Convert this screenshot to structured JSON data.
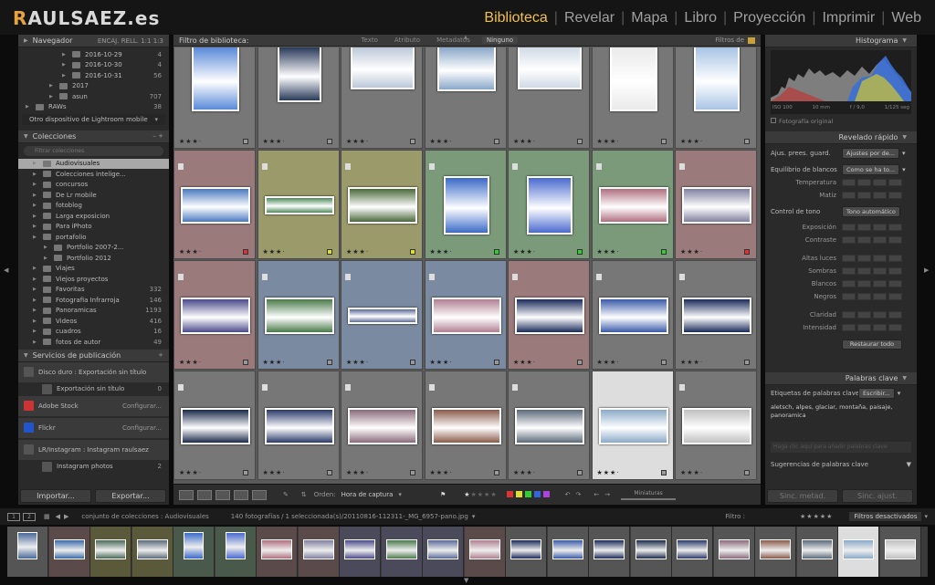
{
  "header": {
    "logo_a": "R",
    "logo_b": "AULSAEZ.es",
    "logo_y": "",
    "modules": [
      "Biblioteca",
      "Revelar",
      "Mapa",
      "Libro",
      "Proyección",
      "Imprimir",
      "Web"
    ],
    "active_module": "Biblioteca"
  },
  "left": {
    "navigator": {
      "title": "Navegador",
      "zoom_opts": "ENCAJ.   RELL.   1:1   1:3"
    },
    "folders": [
      {
        "label": "2016-10-29",
        "count": "4"
      },
      {
        "label": "2016-10-30",
        "count": "4"
      },
      {
        "label": "2016-10-31",
        "count": "56"
      },
      {
        "label": "2017",
        "count": ""
      },
      {
        "label": "asun",
        "count": "707"
      }
    ],
    "raws": {
      "label": "RAWs",
      "count": "38"
    },
    "mobile": "Otro dispositivo de Lightroom mobile",
    "collections_title": "Colecciones",
    "collections_filter_placeholder": "Filtrar colecciones",
    "collections": [
      {
        "label": "Audiovisuales",
        "count": "",
        "sel": true
      },
      {
        "label": "Colecciones intelige...",
        "count": ""
      },
      {
        "label": "concursos",
        "count": ""
      },
      {
        "label": "De Lr mobile",
        "count": ""
      },
      {
        "label": "fotoblog",
        "count": ""
      },
      {
        "label": "Larga exposicion",
        "count": ""
      },
      {
        "label": "Para iPhoto",
        "count": ""
      },
      {
        "label": "portafolio",
        "count": ""
      },
      {
        "label": "Portfolio 2007-2...",
        "count": "",
        "sub": true
      },
      {
        "label": "Portfolio 2012",
        "count": "",
        "sub": true
      },
      {
        "label": "Viajes",
        "count": ""
      },
      {
        "label": "Viejos proyectos",
        "count": ""
      },
      {
        "label": "Favoritas",
        "count": "332"
      },
      {
        "label": "Fotografia Infrarroja",
        "count": "146"
      },
      {
        "label": "Panoramicas",
        "count": "1193"
      },
      {
        "label": "Videos",
        "count": "416"
      },
      {
        "label": "cuadros",
        "count": "16"
      },
      {
        "label": "fotos de autor",
        "count": "49"
      }
    ],
    "publish_title": "Servicios de publicación",
    "publish": [
      {
        "label": "Disco duro : Exportación sin título",
        "action": ""
      },
      {
        "label": "Exportación sin título",
        "action": "0"
      },
      {
        "label": "Adobe Stock",
        "action": "Configurar..."
      },
      {
        "label": "Flickr",
        "action": "Configurar..."
      },
      {
        "label": "LR/Instagram : Instagram raulsaez",
        "action": ""
      },
      {
        "label": "Instagram photos",
        "action": "2"
      }
    ],
    "import_btn": "Importar...",
    "export_btn": "Exportar..."
  },
  "center": {
    "filter_title": "Filtro de biblioteca:",
    "filters": [
      "Texto",
      "Atributo",
      "Metadatos",
      "Ninguno"
    ],
    "active_filter": "Ninguno",
    "filters_off": "Filtros de",
    "sort_label": "Orden:",
    "sort_value": "Hora de captura",
    "thumbs_label": "Miniaturas"
  },
  "right": {
    "histogram_title": "Histograma",
    "exif": [
      "ISO 100",
      "10 mm",
      "f / 9,0",
      "1/125 seg"
    ],
    "original": "Fotografía original",
    "quick_title": "Revelado rápido",
    "preset_label": "Ajus. prees. guard.",
    "preset_val": "Ajustes por de...",
    "wb_label": "Equilibrio de blancos",
    "wb_val": "Como se ha to...",
    "temp": "Temperatura",
    "tint": "Matiz",
    "tone_label": "Control de tono",
    "tone_val": "Tono automático",
    "tone_rows": [
      "Exposición",
      "Contraste",
      "Altas luces",
      "Sombras",
      "Blancos",
      "Negros",
      "Claridad",
      "Intensidad"
    ],
    "reset": "Restaurar todo",
    "kw_title": "Palabras clave",
    "kw_label": "Etiquetas de palabras clave",
    "kw_val": "Escribir...",
    "kw_text": "aletsch, alpes, glaciar, montaña, paisaje, panoramica",
    "kw_placeholder": "Haga clic aquí para añadir palabras clave",
    "kw_suggest": "Sugerencias de palabras clave",
    "sync_meta": "Sinc. metad.",
    "sync_set": "Sinc. ajust."
  },
  "filmstrip": {
    "collection": "conjunto de colecciones : Audiovisuales",
    "count": "140 fotografías",
    "selected": "1 seleccionada(s)",
    "file": "/20110816-112311-_MG_6957-pano.jpg",
    "filter_label": "Filtro :",
    "filters_off": "Filtros desactivados",
    "page1": "1",
    "page2": "2"
  }
}
